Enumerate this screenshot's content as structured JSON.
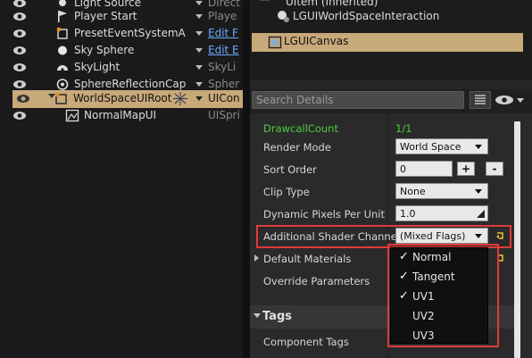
{
  "outliner": {
    "rows": [
      {
        "label": "Light Source",
        "type": "Direct"
      },
      {
        "label": "Player Start",
        "type": "Playe"
      },
      {
        "label": "PresetEventSystemA",
        "type": "Edit F"
      },
      {
        "label": "Sky Sphere",
        "type": "Edit E"
      },
      {
        "label": "SkyLight",
        "type": "SkyLi"
      },
      {
        "label": "SphereReflectionCap",
        "type": "Spher"
      },
      {
        "label": "WorldSpaceUIRoot",
        "type": "UICon"
      },
      {
        "label": "NormalMapUI",
        "type": "UISpri"
      }
    ]
  },
  "components": {
    "inherited_label": "UItem (Inherited)",
    "interaction_label": "LGUIWorldSpaceInteraction",
    "canvas_label": "LGUICanvas"
  },
  "search": {
    "placeholder": "Search Details"
  },
  "details": {
    "drawcall_label": "DrawcallCount",
    "drawcall_value": "1/1",
    "render_mode_label": "Render Mode",
    "render_mode_value": "World Space",
    "sort_order_label": "Sort Order",
    "sort_order_value": "0",
    "plus_label": "+",
    "minus_label": "-",
    "clip_type_label": "Clip Type",
    "clip_type_value": "None",
    "dpi_label": "Dynamic Pixels Per Unit",
    "dpi_value": "1.0",
    "shader_channels_label": "Additional Shader Channels",
    "shader_channels_value": "(Mixed Flags)",
    "default_materials_label": "Default Materials",
    "override_params_label": "Override Parameters",
    "tags_section": "Tags",
    "component_tags_label": "Component Tags"
  },
  "menu": {
    "items": [
      {
        "label": "Normal",
        "checked": true
      },
      {
        "label": "Tangent",
        "checked": true
      },
      {
        "label": "UV1",
        "checked": true
      },
      {
        "label": "UV2",
        "checked": false
      },
      {
        "label": "UV3",
        "checked": false
      }
    ],
    "check_glyph": "✓"
  },
  "colors": {
    "selection": "#c8a97a",
    "highlight": "#e03a3a",
    "link": "#6aa9ff",
    "drawcall": "#4ccd3e"
  },
  "icons": {
    "eye": "eye-icon",
    "search_options": "grid-view-icon"
  }
}
